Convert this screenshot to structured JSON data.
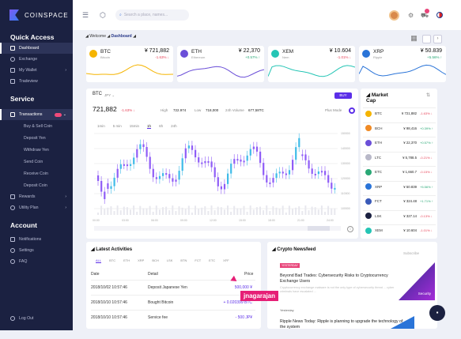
{
  "brand": "COINSPACE",
  "sidebar": {
    "quick_access": "Quick Access",
    "service": "Service",
    "account": "Account",
    "quick": [
      "Dashboard",
      "Exchange",
      "My Wallet",
      "Tradeview"
    ],
    "service_items": [
      "Transactions",
      "Buy & Sell Coin",
      "Deposit Yen",
      "Withdraw Yen",
      "Send Coin",
      "Receive Coin",
      "Deposit Coin",
      "Rewards",
      "Utility Plan"
    ],
    "account_items": [
      "Notifications",
      "Settings",
      "FAQ"
    ],
    "logout": "Log Out"
  },
  "header": {
    "search_placeholder": "Search a place, names..."
  },
  "breadcrumb": {
    "a": "Welcome",
    "b": "Dashboard"
  },
  "tickers": [
    {
      "sym": "BTC",
      "name": "Bitcoin",
      "price": "¥ 721,882",
      "chg": "-1.63% ↓",
      "dir": "dn",
      "color": "#f5b400"
    },
    {
      "sym": "ETH",
      "name": "Ethereum",
      "price": "¥ 22,370",
      "chg": "+0.57% ↑",
      "dir": "up",
      "color": "#6b4fd8"
    },
    {
      "sym": "XEM",
      "name": "Nem",
      "price": "¥ 10.604",
      "chg": "-1.01% ↓",
      "dir": "dn",
      "color": "#25c5b5"
    },
    {
      "sym": "XRP",
      "name": "Ripple",
      "price": "¥ 50.839",
      "chg": "+5.56% ↑",
      "dir": "up",
      "color": "#2a74d8"
    }
  ],
  "main": {
    "pair": "BTC",
    "pair_unit": "JPY ⌄",
    "price": "721,882",
    "change": "-1.63% ↓",
    "high_lbl": "High",
    "high": "722.974",
    "low_lbl": "Low",
    "low": "718,000",
    "vol_lbl": "24h Volume",
    "vol": "677,58TC",
    "buy": "BUY",
    "plus": "Plus Mode",
    "ranges": [
      "1min",
      "5 min",
      "15min",
      "1h",
      "6h",
      "24h"
    ],
    "xticks": [
      "00:00",
      "03:00",
      "06:00",
      "09:00",
      "12:00",
      "15:00",
      "18:00",
      "21:00",
      "24:00"
    ],
    "yticks": [
      "150000",
      "140000",
      "130000",
      "120000",
      "110000",
      "100000"
    ]
  },
  "market_cap": {
    "title": "Market Cap",
    "rows": [
      {
        "s": "BTC",
        "p": "¥ 721,882",
        "c": "-1.63% ↓",
        "d": "dn",
        "col": "#f5b400"
      },
      {
        "s": "BCH",
        "p": "¥ 98,416",
        "c": "+0.39% ↑",
        "d": "up",
        "col": "#f08a24"
      },
      {
        "s": "ETH",
        "p": "¥ 22,370",
        "c": "+0.57% ↑",
        "d": "up",
        "col": "#6b4fd8"
      },
      {
        "s": "LTC",
        "p": "¥ 5,788.5",
        "c": "-0.21% ↓",
        "d": "dn",
        "col": "#b8b8c8"
      },
      {
        "s": "ETC",
        "p": "¥ 1,660.7",
        "c": "-0.15% ↓",
        "d": "dn",
        "col": "#2aa876"
      },
      {
        "s": "XRP",
        "p": "¥ 50.839",
        "c": "+5.56% ↑",
        "d": "up",
        "col": "#2a74d8"
      },
      {
        "s": "FCT",
        "p": "¥ 324.48",
        "c": "+1.71% ↑",
        "d": "up",
        "col": "#3a5ab8"
      },
      {
        "s": "LSK",
        "p": "¥ 327.14",
        "c": "-0.13% ↓",
        "d": "dn",
        "col": "#1b2141"
      },
      {
        "s": "XEM",
        "p": "¥ 10.604",
        "c": "-1.01% ↓",
        "d": "dn",
        "col": "#25c5b5"
      }
    ]
  },
  "activities": {
    "title": "Latest Activities",
    "tabs": [
      "ALL",
      "BTC",
      "ETH",
      "XRP",
      "BCH",
      "LSK",
      "BTN",
      "FCT",
      "ETC",
      "XFF"
    ],
    "h_date": "Date",
    "h_detail": "Detail",
    "h_price": "Price",
    "rows": [
      {
        "date": "2018/10/02 10:57:46",
        "detail": "Deposit Japanese Yen",
        "price": "500,000 ¥"
      },
      {
        "date": "2018/10/10 10:57:46",
        "detail": "Bought Bitcoin",
        "price": "+ 0.020399 BTC"
      },
      {
        "date": "2018/10/10 10:57:46",
        "detail": "Service fee",
        "price": "- 500 JP¥"
      }
    ]
  },
  "news": {
    "title": "Crypto Newsfeed",
    "more": "Subscribe",
    "tag": "YESTERDAY",
    "h1": "Beyond Bad Trades: Cybersecurity Risks to Cryptocurrency Exchange Users",
    "p1": "Cryptocurrency exchange malware is not the only type of cybersecurity threat ... cyber criminals have escalated ...",
    "thumb": "Security",
    "yesterday": "Yesterday",
    "h2": "Ripple News Today: Ripple is planning to upgrade the technology of the system"
  },
  "watermark": "jnagarajan"
}
